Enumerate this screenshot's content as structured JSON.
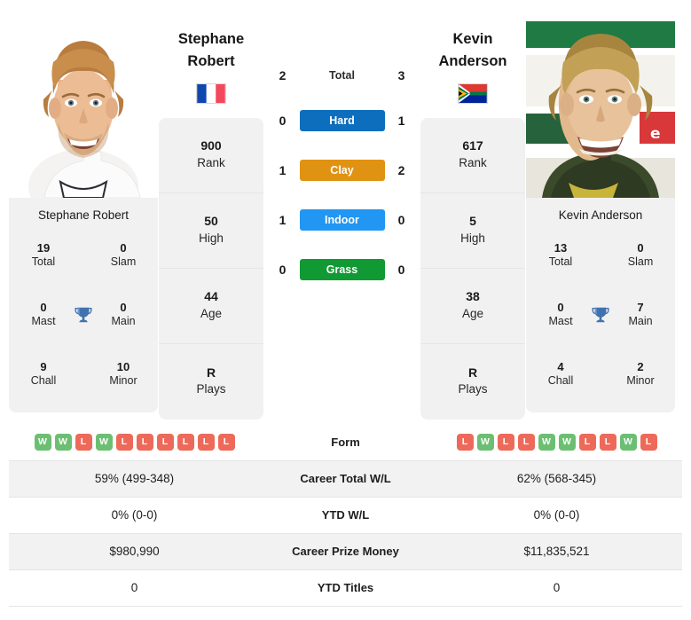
{
  "players": {
    "left": {
      "name": "Stephane Robert",
      "name_line1": "Stephane",
      "name_line2": "Robert",
      "caption": "Stephane Robert",
      "country": "France",
      "flag_icon": "flag-france",
      "titles": {
        "total_val": "19",
        "total_lbl": "Total",
        "slam_val": "0",
        "slam_lbl": "Slam",
        "mast_val": "0",
        "mast_lbl": "Mast",
        "main_val": "0",
        "main_lbl": "Main",
        "chall_val": "9",
        "chall_lbl": "Chall",
        "minor_val": "10",
        "minor_lbl": "Minor"
      },
      "stats": [
        {
          "value": "900",
          "label": "Rank"
        },
        {
          "value": "50",
          "label": "High"
        },
        {
          "value": "44",
          "label": "Age"
        },
        {
          "value": "R",
          "label": "Plays"
        }
      ],
      "form": [
        "W",
        "W",
        "L",
        "W",
        "L",
        "L",
        "L",
        "L",
        "L",
        "L"
      ],
      "career_total_wl": "59% (499-348)",
      "ytd_wl": "0% (0-0)",
      "career_prize_money": "$980,990",
      "ytd_titles": "0"
    },
    "right": {
      "name": "Kevin Anderson",
      "name_line1": "Kevin",
      "name_line2": "Anderson",
      "caption": "Kevin Anderson",
      "country": "South Africa",
      "flag_icon": "flag-south-africa",
      "titles": {
        "total_val": "13",
        "total_lbl": "Total",
        "slam_val": "0",
        "slam_lbl": "Slam",
        "mast_val": "0",
        "mast_lbl": "Mast",
        "main_val": "7",
        "main_lbl": "Main",
        "chall_val": "4",
        "chall_lbl": "Chall",
        "minor_val": "2",
        "minor_lbl": "Minor"
      },
      "stats": [
        {
          "value": "617",
          "label": "Rank"
        },
        {
          "value": "5",
          "label": "High"
        },
        {
          "value": "38",
          "label": "Age"
        },
        {
          "value": "R",
          "label": "Plays"
        }
      ],
      "form": [
        "L",
        "W",
        "L",
        "L",
        "W",
        "W",
        "L",
        "L",
        "W",
        "L"
      ],
      "career_total_wl": "62% (568-345)",
      "ytd_wl": "0% (0-0)",
      "career_prize_money": "$11,835,521",
      "ytd_titles": "0"
    }
  },
  "head_to_head": [
    {
      "label": "Total",
      "left": "2",
      "right": "3",
      "type": "text",
      "color": ""
    },
    {
      "label": "Hard",
      "left": "0",
      "right": "1",
      "type": "badge",
      "color": "#0d6ebd"
    },
    {
      "label": "Clay",
      "left": "1",
      "right": "2",
      "type": "badge",
      "color": "#e09212"
    },
    {
      "label": "Indoor",
      "left": "1",
      "right": "0",
      "type": "badge",
      "color": "#2196f3"
    },
    {
      "label": "Grass",
      "left": "0",
      "right": "0",
      "type": "badge",
      "color": "#119934"
    }
  ],
  "table_rows": [
    {
      "label": "Form",
      "left": "",
      "right": "",
      "type": "form",
      "shaded": false
    },
    {
      "label": "Career Total W/L",
      "left": "59% (499-348)",
      "right": "62% (568-345)",
      "type": "text",
      "shaded": true
    },
    {
      "label": "YTD W/L",
      "left": "0% (0-0)",
      "right": "0% (0-0)",
      "type": "text",
      "shaded": false
    },
    {
      "label": "Career Prize Money",
      "left": "$980,990",
      "right": "$11,835,521",
      "type": "text",
      "shaded": true
    },
    {
      "label": "YTD Titles",
      "left": "0",
      "right": "0",
      "type": "text",
      "shaded": false
    }
  ],
  "colors": {
    "win": "#6cbf72",
    "loss": "#ed6a5a",
    "trophy": "#4172b0",
    "card_bg": "#f1f1f1",
    "row_shade": "#f2f2f2"
  },
  "icons": {
    "trophy": "trophy-icon"
  }
}
